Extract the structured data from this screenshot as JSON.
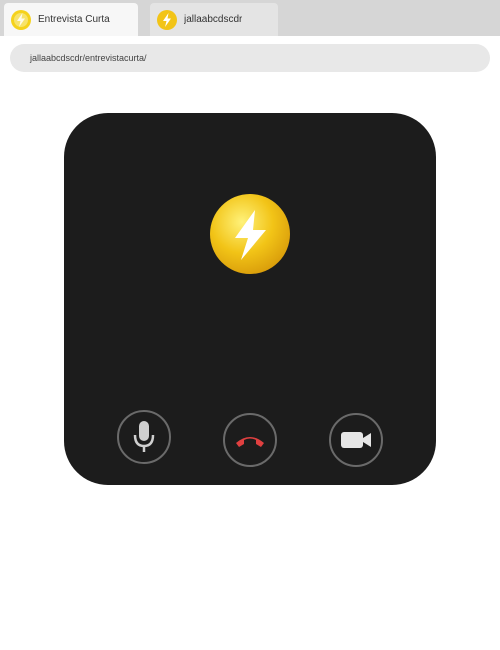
{
  "tabs": [
    {
      "label": "Entrevista Curta",
      "icon": "bolt-logo-icon",
      "active": true
    },
    {
      "label": "jallaabcdscdr",
      "icon": "bolt-logo-icon",
      "active": false
    }
  ],
  "address_bar": {
    "url": "jallaabcdscdr/entrevistacurta/"
  },
  "call": {
    "avatar_icon": "lightning-bolt-icon",
    "controls": [
      {
        "name": "microphone-button",
        "icon": "microphone-icon"
      },
      {
        "name": "hang-up-button",
        "icon": "phone-hangup-icon",
        "color": "#e04040"
      },
      {
        "name": "video-button",
        "icon": "video-camera-icon"
      }
    ],
    "colors": {
      "card_background": "#1c1c1c",
      "accent_yellow": "#f2c417",
      "hangup_red": "#e04040"
    }
  }
}
